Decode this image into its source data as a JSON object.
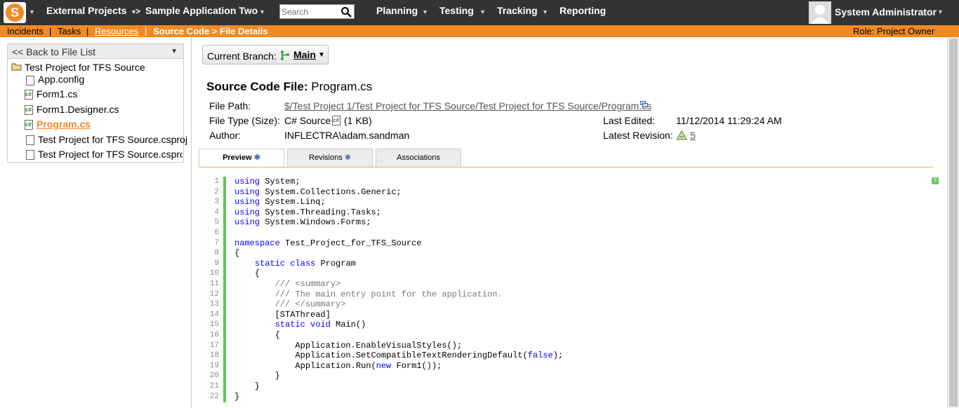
{
  "topbar": {
    "project": "External Projects",
    "separator": ">",
    "application": "Sample Application Two",
    "search_placeholder": "Search",
    "menu": [
      "Planning",
      "Testing",
      "Tracking",
      "Reporting"
    ],
    "user": "System Administrator"
  },
  "subbar": {
    "items": [
      "Incidents",
      "Tasks",
      "Resources"
    ],
    "current": "Source Code > File Details",
    "role": "Role: Project Owner"
  },
  "left": {
    "back": "<< Back to File List",
    "root": "Test Project for TFS Source",
    "files": [
      "App.config",
      "Form1.cs",
      "Form1.Designer.cs",
      "Program.cs",
      "Test Project for TFS Source.csproj",
      "Test Project for TFS Source.csproj."
    ]
  },
  "branch": {
    "label": "Current Branch:",
    "value": "Main"
  },
  "file": {
    "title_label": "Source Code File:",
    "title_value": "Program.cs",
    "path_label": "File Path:",
    "path_value": "$/Test Project 1/Test Project for TFS Source/Test Project for TFS Source/Program.cs",
    "type_label": "File Type (Size):",
    "type_value": "C# Source",
    "size_value": "(1 KB)",
    "author_label": "Author:",
    "author_value": "INFLECTRA\\adam.sandman",
    "edited_label": "Last Edited:",
    "edited_value": "11/12/2014 11:29:24 AM",
    "revision_label": "Latest Revision:",
    "revision_value": "5"
  },
  "tabs": [
    "Preview",
    "Revisions",
    "Associations"
  ],
  "code": {
    "lines": [
      "using System;",
      "using System.Collections.Generic;",
      "using System.Linq;",
      "using System.Threading.Tasks;",
      "using System.Windows.Forms;",
      "",
      "namespace Test_Project_for_TFS_Source",
      "{",
      "    static class Program",
      "    {",
      "        /// <summary>",
      "        /// The main entry point for the application.",
      "        /// </summary>",
      "        [STAThread]",
      "        static void Main()",
      "        {",
      "            Application.EnableVisualStyles();",
      "            Application.SetCompatibleTextRenderingDefault(false);",
      "            Application.Run(new Form1());",
      "        }",
      "    }",
      "}"
    ]
  },
  "colors": {
    "topbar": "#333333",
    "accent": "#f08a24",
    "code_gutter": "#5fc45f",
    "keyword": "#0000ff"
  }
}
